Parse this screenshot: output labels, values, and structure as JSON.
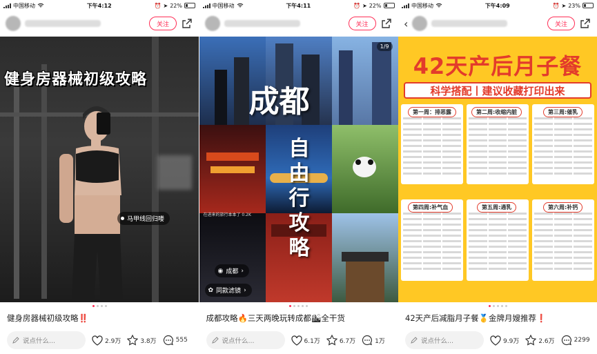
{
  "panels": [
    {
      "status": {
        "carrier": "中国移动",
        "time": "下午4:12",
        "battery": "22%",
        "battery_level": 0.22
      },
      "follow": "关注",
      "image": {
        "overlay_title": "健身房器械初级攻略",
        "tag": "马甲线回归喽"
      },
      "caption": "健身房器械初级攻略‼️",
      "comment_placeholder": "说点什么...",
      "likes": "2.9万",
      "collects": "3.8万",
      "comments": "555",
      "page_dots": 4,
      "active_dot": 0
    },
    {
      "status": {
        "carrier": "中国移动",
        "time": "下午4:11",
        "battery": "22%",
        "battery_level": 0.22
      },
      "follow": "关注",
      "image": {
        "page_counter": "1/9",
        "big_title": "成都",
        "vertical_title": "自由行攻略",
        "chip_location": "成都",
        "chip_filter": "同款滤镜",
        "small_text": "在进来的旅行本本了 0.2K"
      },
      "caption": "成都攻略🔥三天两晚玩转成都🏙全干货",
      "comment_placeholder": "说点什么...",
      "likes": "6.1万",
      "collects": "6.7万",
      "comments": "1万",
      "page_dots": 5,
      "active_dot": 0
    },
    {
      "status": {
        "carrier": "中国移动",
        "time": "下午4:09",
        "battery": "23%",
        "battery_level": 0.23
      },
      "follow": "关注",
      "image": {
        "title": "42天产后月子餐",
        "subtitle": "科学搭配丨建议收藏打印出来",
        "weeks": [
          "第一周：排恶露",
          "第二周:收缩内脏",
          "第三周:催乳",
          "第四周:补气血",
          "第五周:通乳",
          "第六周:补钙"
        ]
      },
      "caption": "42天产后减脂月子餐🥇金牌月嫂推荐❗",
      "comment_placeholder": "说点什么...",
      "likes": "9.9万",
      "collects": "2.6万",
      "comments": "2299",
      "page_dots": 5,
      "active_dot": 0
    }
  ],
  "colors": {
    "accent": "#ff2d55",
    "poster_red": "#e33b2b",
    "poster_yellow": "#ffc824"
  },
  "icons": [
    "wifi-icon",
    "alarm-icon",
    "location-icon",
    "battery-icon",
    "share-icon",
    "back-icon",
    "pencil-icon",
    "heart-icon",
    "star-icon",
    "comment-icon"
  ]
}
